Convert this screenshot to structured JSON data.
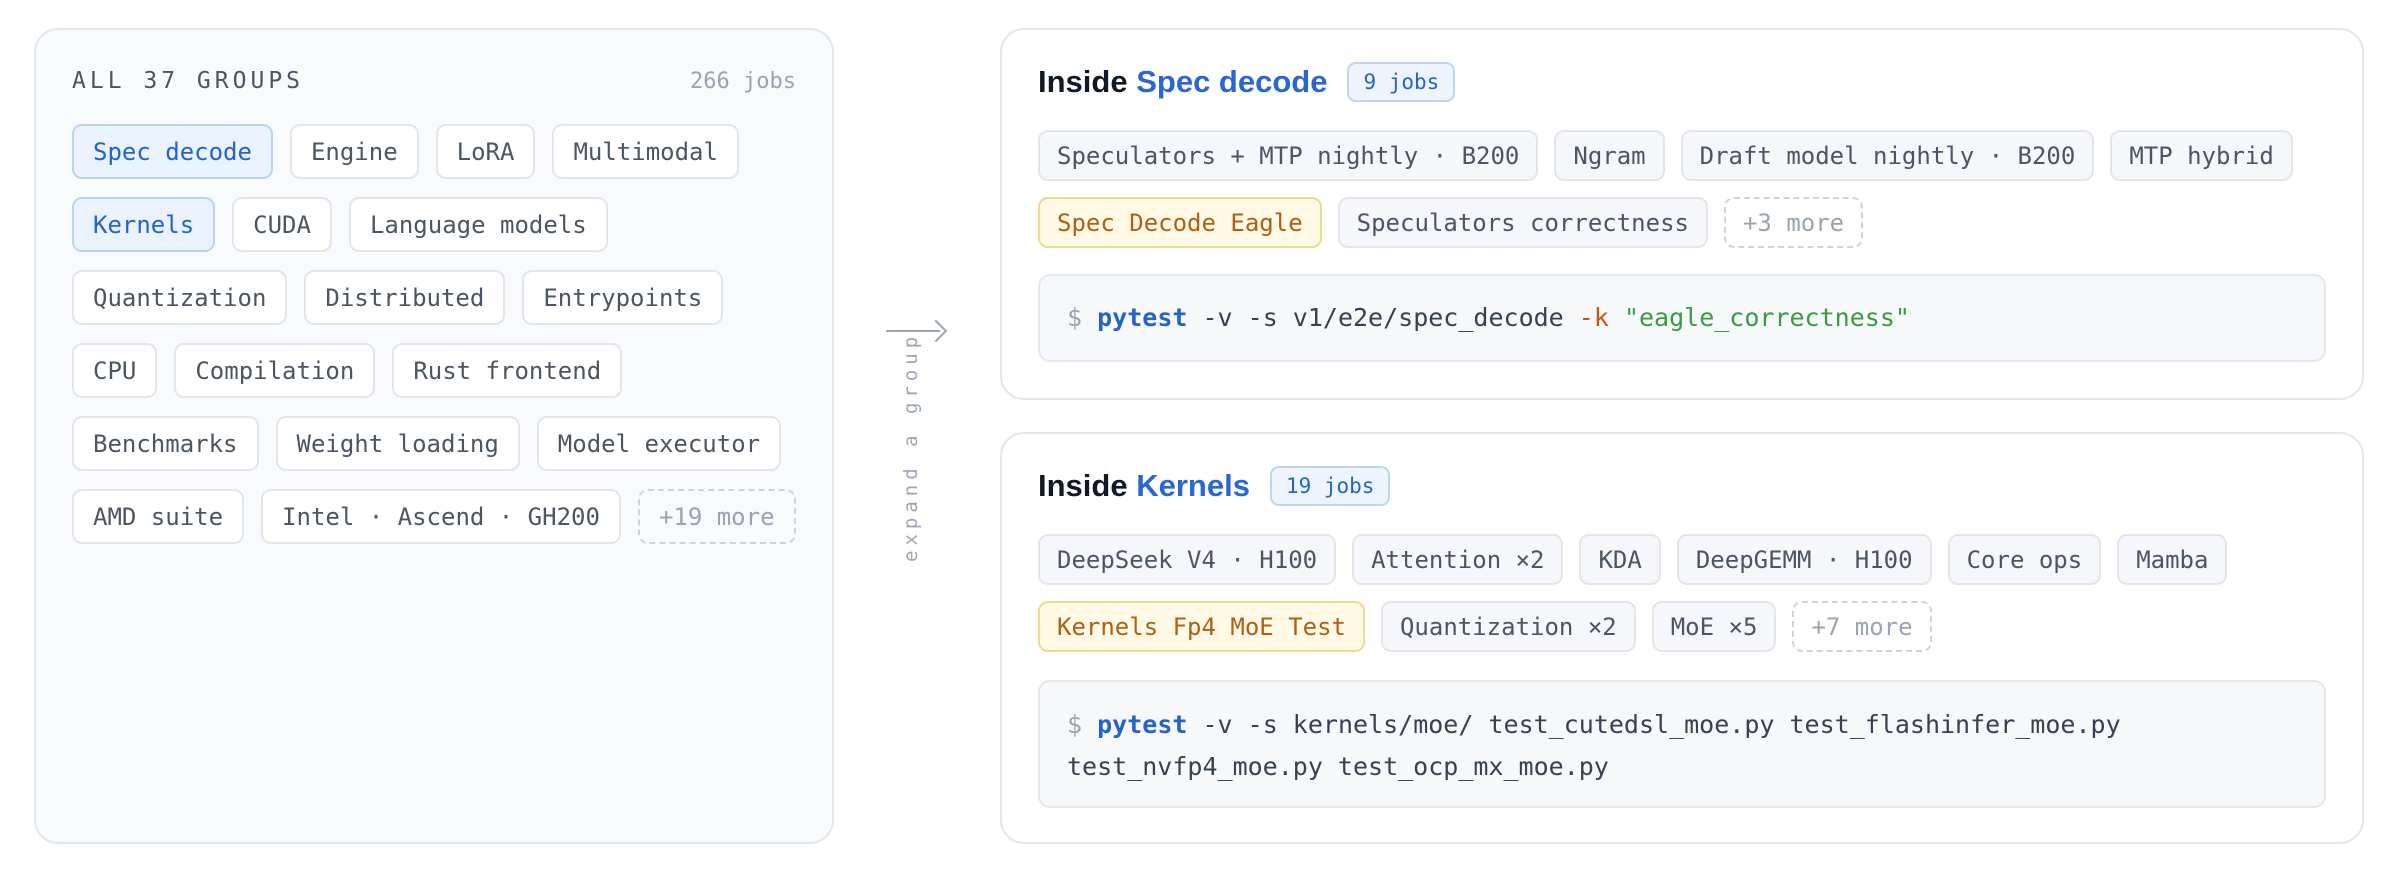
{
  "overview": {
    "title": "ALL 37 GROUPS",
    "count": "266 jobs",
    "groups": [
      {
        "label": "Spec decode",
        "state": "selected"
      },
      {
        "label": "Engine",
        "state": "normal"
      },
      {
        "label": "LoRA",
        "state": "normal"
      },
      {
        "label": "Multimodal",
        "state": "normal"
      },
      {
        "label": "Kernels",
        "state": "selected"
      },
      {
        "label": "CUDA",
        "state": "normal"
      },
      {
        "label": "Language models",
        "state": "normal"
      },
      {
        "label": "Quantization",
        "state": "normal"
      },
      {
        "label": "Distributed",
        "state": "normal"
      },
      {
        "label": "Entrypoints",
        "state": "normal"
      },
      {
        "label": "CPU",
        "state": "normal"
      },
      {
        "label": "Compilation",
        "state": "normal"
      },
      {
        "label": "Rust frontend",
        "state": "normal"
      },
      {
        "label": "Benchmarks",
        "state": "normal"
      },
      {
        "label": "Weight loading",
        "state": "normal"
      },
      {
        "label": "Model executor",
        "state": "normal"
      },
      {
        "label": "AMD suite",
        "state": "normal"
      },
      {
        "label": "Intel · Ascend · GH200",
        "state": "normal"
      }
    ],
    "more_label": "+19 more"
  },
  "connector": {
    "label": "expand a group"
  },
  "spec_card": {
    "prefix": "Inside",
    "group": "Spec decode",
    "badge": "9 jobs",
    "jobs": [
      {
        "label": "Speculators + MTP nightly · B200",
        "state": "normal"
      },
      {
        "label": "Ngram",
        "state": "normal"
      },
      {
        "label": "Draft model nightly · B200",
        "state": "normal"
      },
      {
        "label": "MTP hybrid",
        "state": "normal"
      },
      {
        "label": "Spec Decode Eagle",
        "state": "warn"
      },
      {
        "label": "Speculators correctness",
        "state": "normal"
      }
    ],
    "more_label": "+3 more",
    "command": {
      "prompt": "$",
      "binary": "pytest",
      "args": " -v -s v1/e2e/spec_decode ",
      "flag": "-k",
      "string": " \"eagle_correctness\"",
      "line2": ""
    }
  },
  "kernels_card": {
    "prefix": "Inside",
    "group": "Kernels",
    "badge": "19 jobs",
    "jobs": [
      {
        "label": "DeepSeek V4 · H100",
        "state": "normal"
      },
      {
        "label": "Attention ×2",
        "state": "normal"
      },
      {
        "label": "KDA",
        "state": "normal"
      },
      {
        "label": "DeepGEMM · H100",
        "state": "normal"
      },
      {
        "label": "Core ops",
        "state": "normal"
      },
      {
        "label": "Mamba",
        "state": "normal"
      },
      {
        "label": "Kernels Fp4 MoE Test",
        "state": "warn"
      },
      {
        "label": "Quantization ×2",
        "state": "normal"
      },
      {
        "label": "MoE ×5",
        "state": "normal"
      }
    ],
    "more_label": "+7 more",
    "command": {
      "prompt": "$",
      "binary": "pytest",
      "args": " -v -s kernels/moe/ test_cutedsl_moe.py test_flashinfer_moe.py",
      "line2": "test_nvfp4_moe.py test_ocp_mx_moe.py"
    }
  },
  "colors": {
    "accent": "#2c66d3",
    "selected_bg": "#e9f2fd",
    "warn_bg": "#fff9e6",
    "warn_text": "#b25f14",
    "string_green": "#3a9b3f",
    "flag_orange": "#c2571a"
  }
}
